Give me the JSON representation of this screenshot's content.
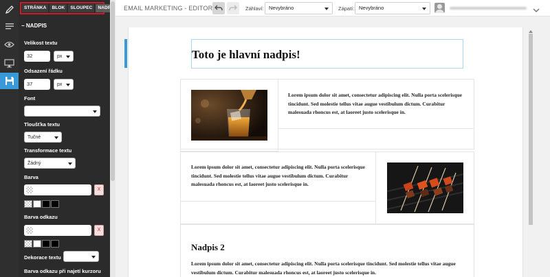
{
  "header": {
    "title": "EMAIL MARKETING - EDITOR",
    "header_label": "Záhlaví:",
    "header_value": "Nevybráno",
    "footer_label": "Zápatí:",
    "footer_value": "Nevybráno"
  },
  "panel": {
    "tabs": [
      {
        "label": "STRÁNKA"
      },
      {
        "label": "BLOK"
      },
      {
        "label": "SLOUPEC"
      },
      {
        "label": "NADPIS"
      }
    ],
    "active_tab": "NADPIS",
    "section_title": "− NADPIS",
    "font_size_label": "Velikost textu",
    "font_size_value": "32",
    "font_size_unit": "px",
    "line_height_label": "Odsazení řádku",
    "line_height_value": "37",
    "line_height_unit": "px",
    "font_label": "Font",
    "font_value": "",
    "weight_label": "Tloušťka textu",
    "weight_value": "Tučné",
    "transform_label": "Transformace textu",
    "transform_value": "Žádný",
    "color_label": "Barva",
    "link_color_label": "Barva odkazu",
    "decoration_label": "Dekorace textu",
    "decoration_value": "",
    "hover_link_label": "Barva odkazu při najetí kurzoru",
    "clear_label": "X"
  },
  "email": {
    "heading": "Toto je hlavní nadpis!",
    "paragraph": "Lorem ipsum dolor sit amet, consectetur adipiscing elit. Nulla porta scelerisque tincidunt. Sed molestie tellus vitae augue vestibulum dictum. Curabitur malesuada rhoncus est, at laoreet justo scelerisque in.",
    "heading2": "Nadpis 2",
    "paragraph_bottom": "Lorem ipsum dolor sit amet, consectetur adipiscing elit. Nulla porta scelerisque tincidunt. Sed molestie tellus vitae augue vestibulum dictum. Curabitur malesuada rhoncus est, at laoreet justo scelerisque in."
  },
  "colors": {
    "accent": "#3a9ad9",
    "panel_bg": "#2b2b2b",
    "tab_highlight": "#d11a2a"
  }
}
